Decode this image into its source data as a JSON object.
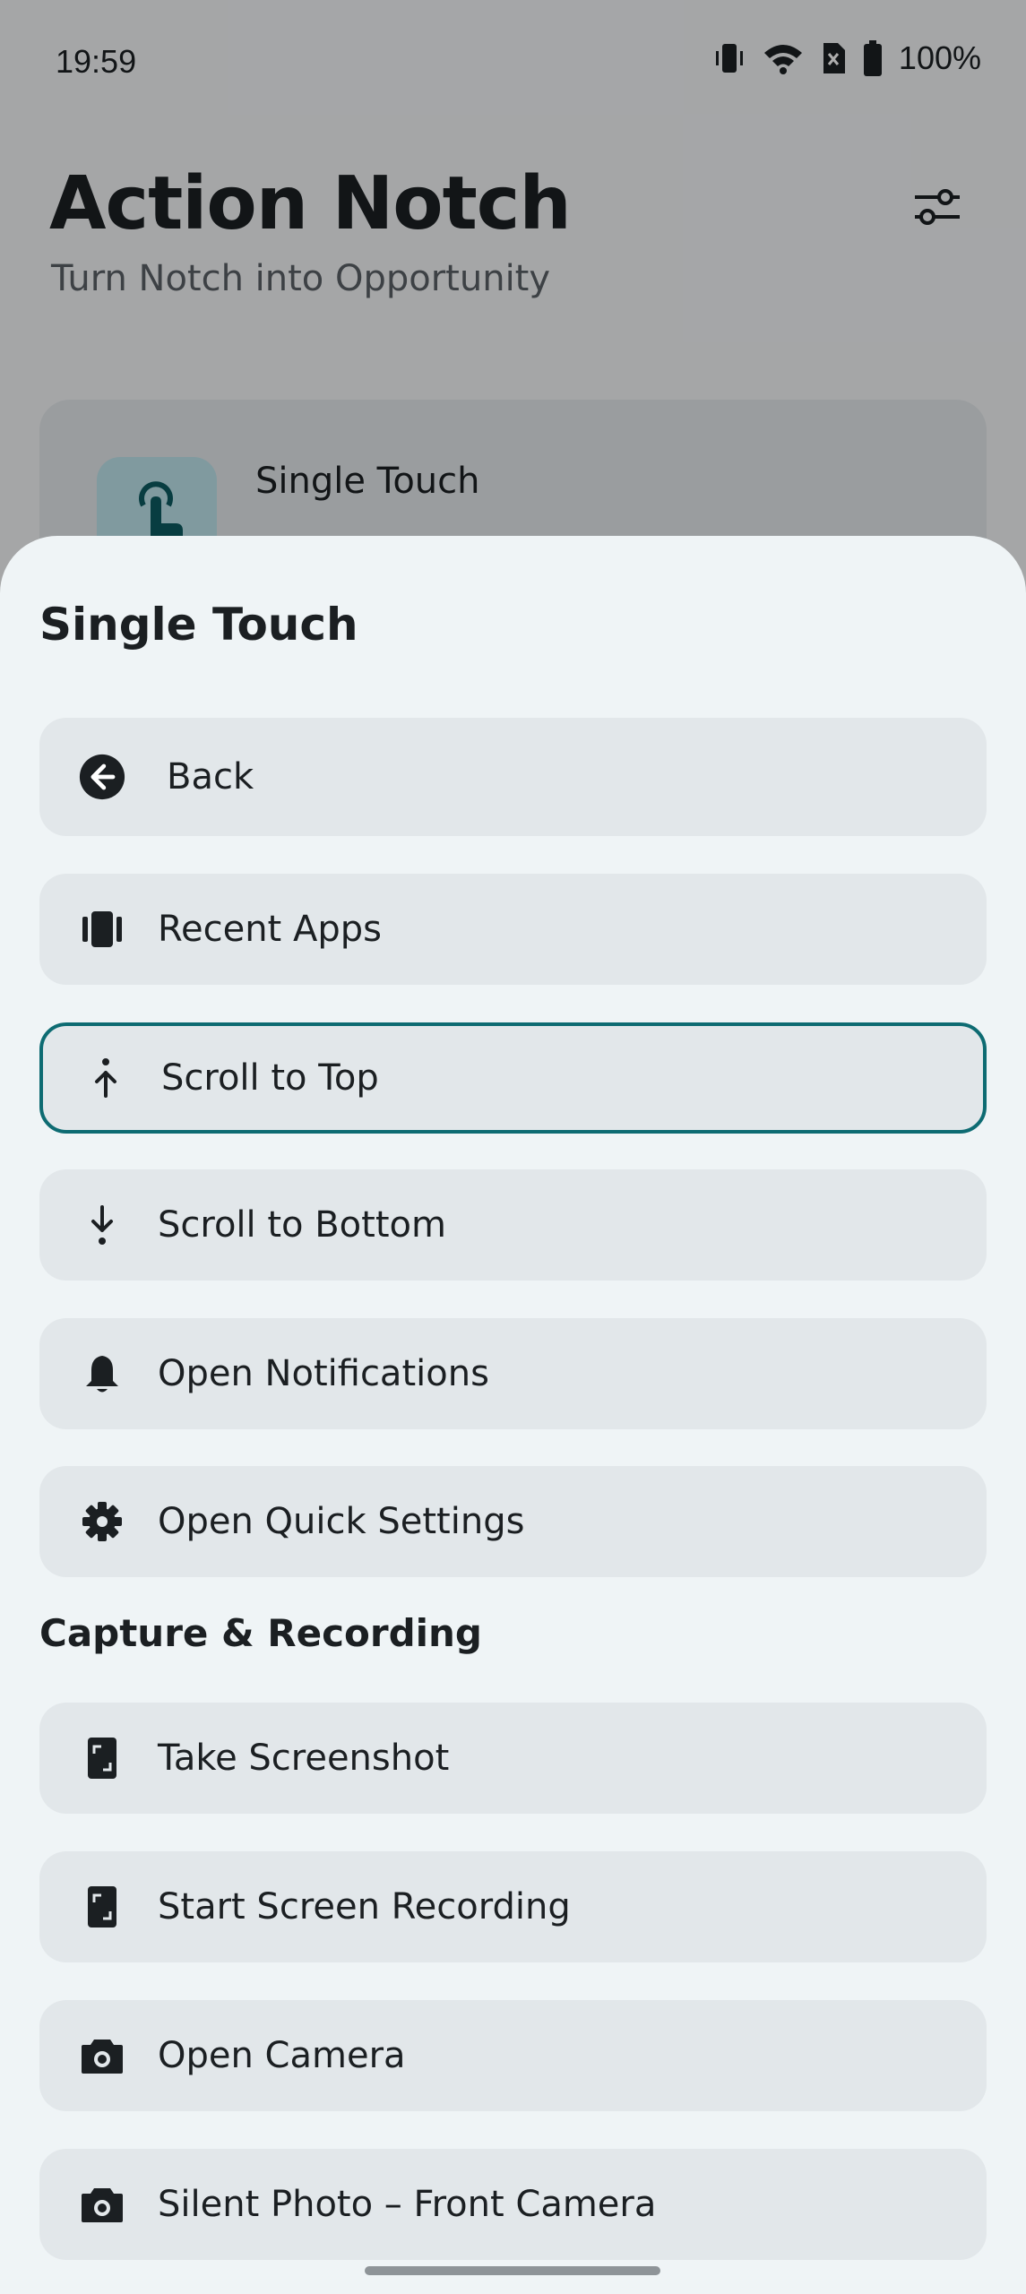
{
  "status_bar": {
    "time": "19:59",
    "battery": "100%",
    "icons": [
      "vibrate-icon",
      "wifi-icon",
      "no-sim-icon",
      "battery-icon"
    ]
  },
  "header": {
    "title": "Action Notch",
    "subtitle": "Turn Notch into Opportunity",
    "settings_icon": "tune-icon"
  },
  "background_card": {
    "label": "Single Touch",
    "icon": "touch-icon"
  },
  "sheet": {
    "title": "Single Touch",
    "options": [
      {
        "label": "Back",
        "icon": "back-arrow-icon",
        "selected": false
      },
      {
        "label": "Recent Apps",
        "icon": "recent-apps-icon",
        "selected": false
      },
      {
        "label": "Scroll to Top",
        "icon": "arrow-up-icon",
        "selected": true
      },
      {
        "label": "Scroll to Bottom",
        "icon": "arrow-down-icon",
        "selected": false
      },
      {
        "label": "Open Notifications",
        "icon": "bell-icon",
        "selected": false
      },
      {
        "label": "Open Quick Settings",
        "icon": "gear-icon",
        "selected": false
      }
    ],
    "section_capture": {
      "title": "Capture & Recording",
      "options": [
        {
          "label": "Take Screenshot",
          "icon": "screenshot-icon"
        },
        {
          "label": "Start Screen Recording",
          "icon": "screen-record-icon"
        },
        {
          "label": "Open Camera",
          "icon": "camera-icon"
        },
        {
          "label": "Silent Photo – Front Camera",
          "icon": "camera-icon"
        }
      ]
    }
  },
  "colors": {
    "accent": "#0d6b72",
    "sheet_bg": "#eff4f6",
    "option_bg": "#e2e7ea",
    "text": "#1b1f22"
  }
}
